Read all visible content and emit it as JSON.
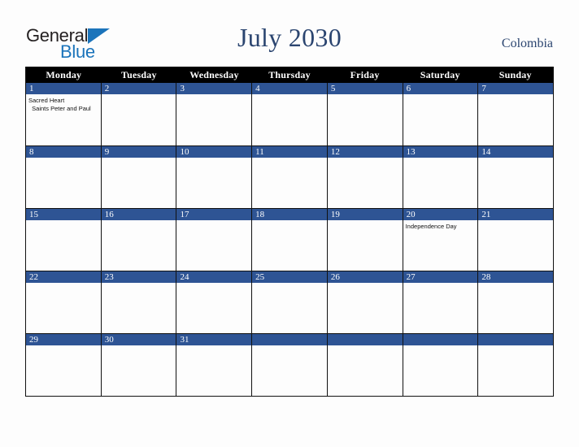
{
  "brand": {
    "name_part1": "General",
    "name_part2": "Blue",
    "triangle_color": "#1B74BB",
    "text_color": "#231F20"
  },
  "header": {
    "title": "July 2030",
    "country": "Colombia",
    "title_color": "#2B4570"
  },
  "calendar": {
    "colors": {
      "dow_header_bg": "#000000",
      "dow_header_text": "#FFFFFF",
      "date_bar_bg": "#2E5494",
      "date_text": "#FFFFFF",
      "cell_bg": "#FDFDFD",
      "border": "#111111"
    },
    "day_headers": [
      "Monday",
      "Tuesday",
      "Wednesday",
      "Thursday",
      "Friday",
      "Saturday",
      "Sunday"
    ],
    "weeks": [
      [
        {
          "date": "1",
          "events": [
            "Sacred Heart",
            "  Saints Peter and Paul"
          ]
        },
        {
          "date": "2",
          "events": []
        },
        {
          "date": "3",
          "events": []
        },
        {
          "date": "4",
          "events": []
        },
        {
          "date": "5",
          "events": []
        },
        {
          "date": "6",
          "events": []
        },
        {
          "date": "7",
          "events": []
        }
      ],
      [
        {
          "date": "8",
          "events": []
        },
        {
          "date": "9",
          "events": []
        },
        {
          "date": "10",
          "events": []
        },
        {
          "date": "11",
          "events": []
        },
        {
          "date": "12",
          "events": []
        },
        {
          "date": "13",
          "events": []
        },
        {
          "date": "14",
          "events": []
        }
      ],
      [
        {
          "date": "15",
          "events": []
        },
        {
          "date": "16",
          "events": []
        },
        {
          "date": "17",
          "events": []
        },
        {
          "date": "18",
          "events": []
        },
        {
          "date": "19",
          "events": []
        },
        {
          "date": "20",
          "events": [
            "Independence Day"
          ]
        },
        {
          "date": "21",
          "events": []
        }
      ],
      [
        {
          "date": "22",
          "events": []
        },
        {
          "date": "23",
          "events": []
        },
        {
          "date": "24",
          "events": []
        },
        {
          "date": "25",
          "events": []
        },
        {
          "date": "26",
          "events": []
        },
        {
          "date": "27",
          "events": []
        },
        {
          "date": "28",
          "events": []
        }
      ],
      [
        {
          "date": "29",
          "events": []
        },
        {
          "date": "30",
          "events": []
        },
        {
          "date": "31",
          "events": []
        },
        {
          "date": "",
          "events": []
        },
        {
          "date": "",
          "events": []
        },
        {
          "date": "",
          "events": []
        },
        {
          "date": "",
          "events": []
        }
      ]
    ]
  }
}
